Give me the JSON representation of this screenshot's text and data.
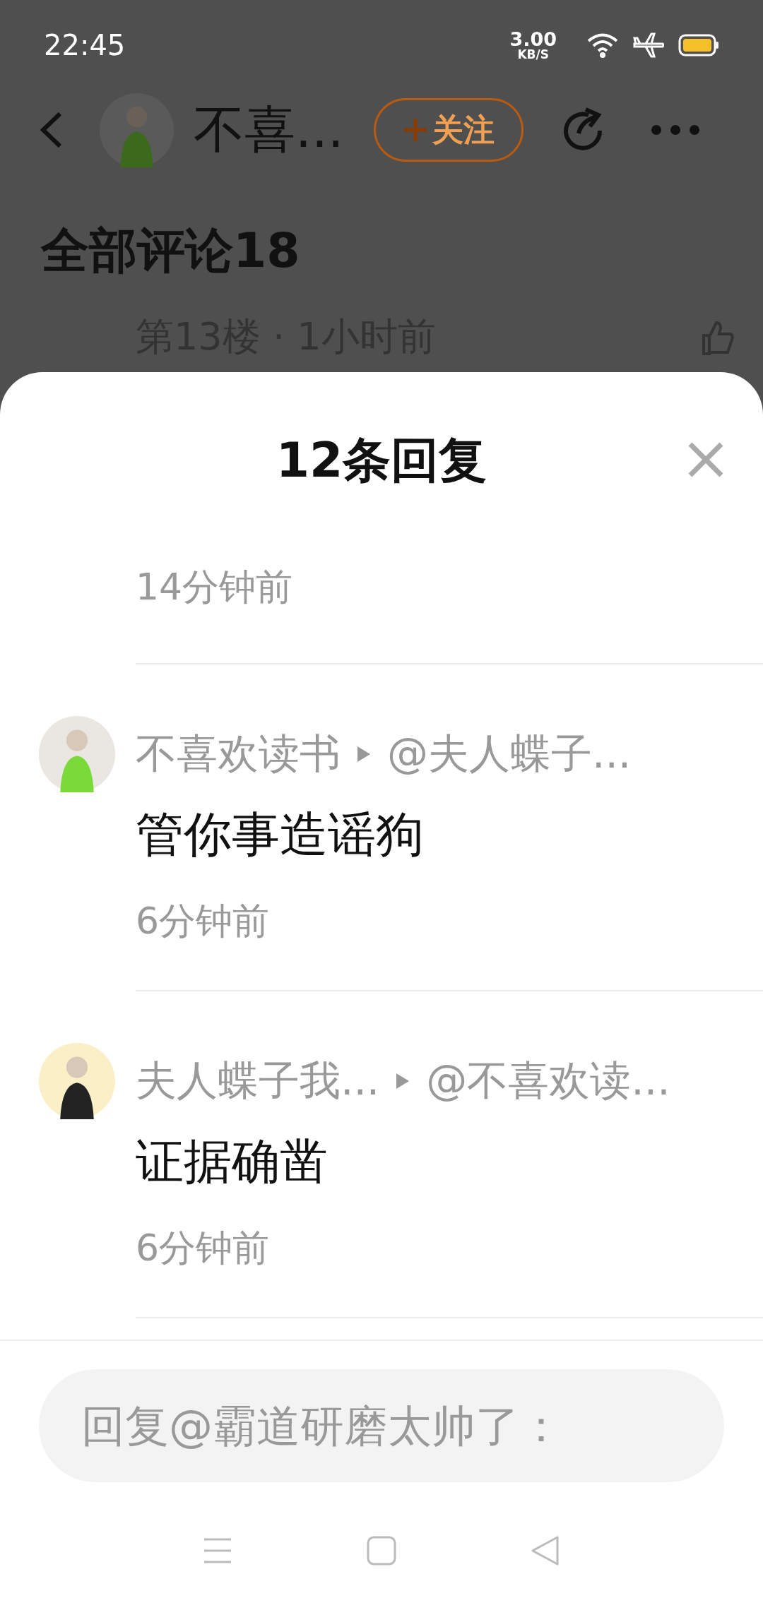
{
  "status_bar": {
    "time": "22:45",
    "net_speed": "3.00",
    "net_unit": "KB/S"
  },
  "header": {
    "name": "不喜...",
    "follow_label": "关注"
  },
  "comments_title": "全部评论18",
  "floor_meta": "第13楼 · 1小时前",
  "sheet": {
    "title": "12条回复",
    "replies": [
      {
        "time": "14分钟前"
      },
      {
        "author": "不喜欢读书",
        "reply_to": "@夫人蝶子...",
        "text": "管你事造谣狗",
        "time": "6分钟前"
      },
      {
        "author": "夫人蝶子我...",
        "reply_to": "@不喜欢读...",
        "text": "证据确凿",
        "time": "6分钟前"
      }
    ],
    "input": {
      "placeholder": "回复@霸道研磨太帅了："
    }
  }
}
